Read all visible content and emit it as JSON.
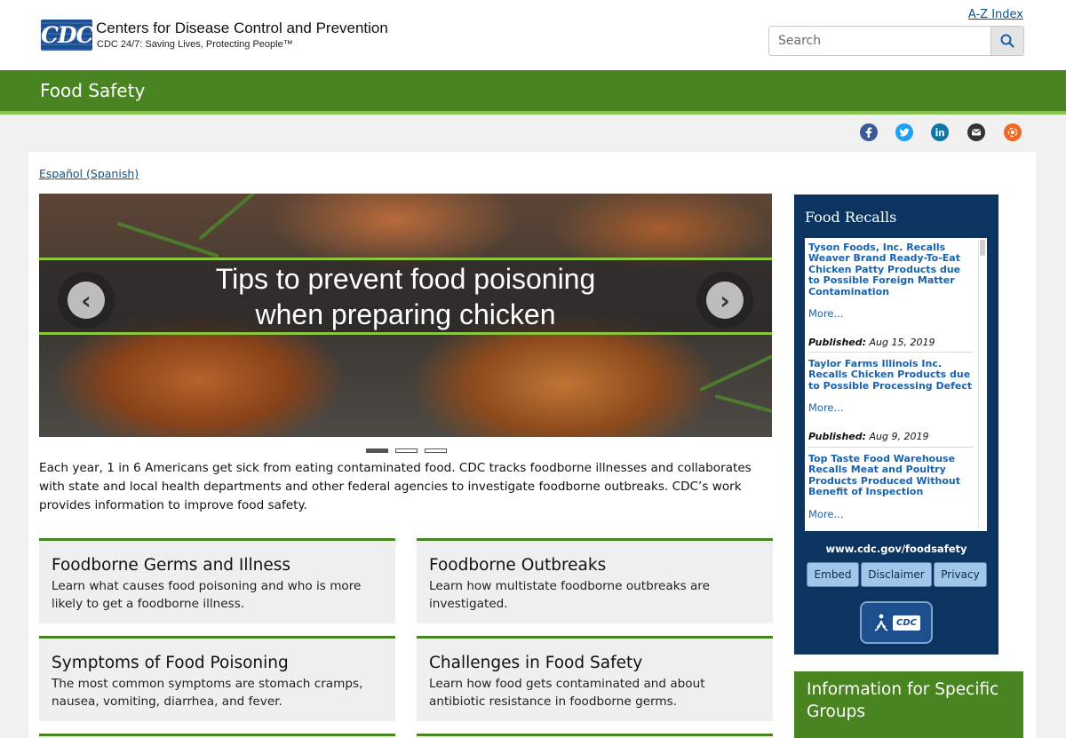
{
  "header": {
    "logo_text": "CDC",
    "org_name": "Centers for Disease Control and Prevention",
    "tagline": "CDC 24/7: Saving Lives, Protecting People™",
    "az_index": "A-Z Index",
    "search_placeholder": "Search"
  },
  "banner": {
    "title": "Food Safety"
  },
  "social": {
    "icons": [
      "facebook-icon",
      "twitter-icon",
      "linkedin-icon",
      "email-icon",
      "syndicate-icon"
    ],
    "colors": {
      "facebook": "#3b5998",
      "twitter": "#1da1f2",
      "linkedin": "#0e76a8",
      "email": "#333333",
      "syndicate": "#f26722"
    }
  },
  "espanol_link": "Español (Spanish)",
  "carousel": {
    "caption_line1": "Tips to prevent food poisoning",
    "caption_line2": "when preparing chicken",
    "prev_label": "‹",
    "next_label": "›",
    "slide_count": 3,
    "active_slide": 1
  },
  "intro": "Each year, 1 in 6 Americans get sick from eating contaminated food. CDC tracks foodborne illnesses and collaborates with state and local health departments and other federal agencies to investigate foodborne outbreaks. CDC’s work provides information to improve food safety.",
  "cards": [
    {
      "title": "Foodborne Germs and Illness",
      "text": "Learn what causes food poisoning and who is more likely to get a foodborne illness."
    },
    {
      "title": "Foodborne Outbreaks",
      "text": "Learn how multistate foodborne outbreaks are investigated."
    },
    {
      "title": "Symptoms of Food Poisoning",
      "text": "The most common symptoms are stomach cramps, nausea, vomiting, diarrhea, and fever."
    },
    {
      "title": "Challenges in Food Safety",
      "text": "Learn how food gets contaminated and about antibiotic resistance in foodborne germs."
    }
  ],
  "recalls": {
    "title": "Food Recalls",
    "published_label": "Published:",
    "more_label": "More...",
    "items": [
      {
        "title": "Tyson Foods, Inc. Recalls Weaver Brand Ready-To-Eat Chicken Patty Products due to Possible Foreign Matter Contamination",
        "date": "Aug 15, 2019"
      },
      {
        "title": "Taylor Farms Illinois Inc. Recalls Chicken Products due to Possible Processing Defect",
        "date": "Aug 9, 2019"
      },
      {
        "title": "Top Taste Food Warehouse Recalls Meat and Poultry Products Produced Without Benefit of Inspection",
        "date": ""
      }
    ],
    "url": "www.cdc.gov/foodsafety",
    "buttons": {
      "embed": "Embed",
      "disclaimer": "Disclaimer",
      "privacy": "Privacy"
    },
    "badge_text": "CDC"
  },
  "groups": {
    "title": "Information for Specific Groups"
  }
}
